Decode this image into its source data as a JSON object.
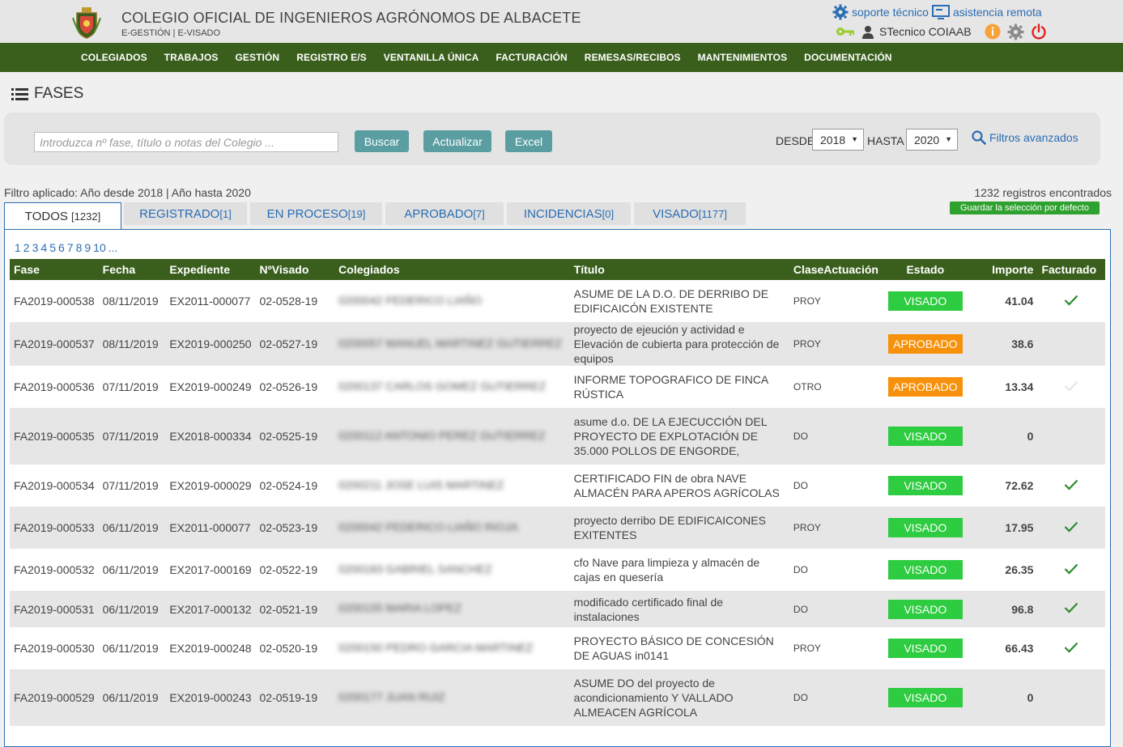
{
  "header": {
    "org_title": "COLEGIO OFICIAL DE INGENIEROS AGRÓNOMOS DE ALBACETE",
    "org_sub": "E-GESTIÓN | E-VISADO",
    "support_link": "soporte técnico",
    "remote_link": "asistencia remota",
    "username": "STecnico COIAAB"
  },
  "nav": {
    "items": [
      "COLEGIADOS",
      "TRABAJOS",
      "GESTIÓN",
      "REGISTRO E/S",
      "VENTANILLA ÚNICA",
      "FACTURACIÓN",
      "REMESAS/RECIBOS",
      "MANTENIMIENTOS",
      "DOCUMENTACIÓN"
    ]
  },
  "page": {
    "title": "FASES"
  },
  "search": {
    "placeholder": "Introduzca nº fase, título o notas del Colegio ...",
    "buscar": "Buscar",
    "actualizar": "Actualizar",
    "excel": "Excel",
    "desde_label": "DESDE",
    "desde_value": "2018",
    "hasta_label": "HASTA",
    "hasta_value": "2020",
    "advanced": "Filtros avanzados"
  },
  "filter": {
    "applied": "Filtro aplicado: Año desde 2018 | Año hasta 2020",
    "records": "1232 registros encontrados",
    "save_default": "Guardar la selección por defecto"
  },
  "tabs": [
    {
      "label": "TODOS ",
      "count": "[1232]"
    },
    {
      "label": "REGISTRADO",
      "count": "[1]"
    },
    {
      "label": "EN PROCESO",
      "count": "[19]"
    },
    {
      "label": "APROBADO",
      "count": "[7]"
    },
    {
      "label": "INCIDENCIAS",
      "count": "[0]"
    },
    {
      "label": "VISADO",
      "count": "[1177]"
    }
  ],
  "pager": [
    "1",
    "2",
    "3",
    "4",
    "5",
    "6",
    "7",
    "8",
    "9",
    "10",
    "..."
  ],
  "table": {
    "columns": [
      "Fase",
      "Fecha",
      "Expediente",
      "NºVisado",
      "Colegiados",
      "Título",
      "ClaseActuación",
      "Estado",
      "Importe",
      "Facturado"
    ],
    "rows": [
      {
        "fase": "FA2019-000538",
        "fecha": "08/11/2019",
        "expediente": "EX2011-000077",
        "visado": "02-0528-19",
        "colegiados": "0200042 FEDERICO LIAÑO",
        "titulo": "ASUME DE LA D.O. DE DERRIBO DE EDIFICAICÓN EXISTENTE",
        "clase": "PROY",
        "estado": "VISADO",
        "importe": "41.04",
        "facturado": true
      },
      {
        "fase": "FA2019-000537",
        "fecha": "08/11/2019",
        "expediente": "EX2019-000250",
        "visado": "02-0527-19",
        "colegiados": "0200057 MANUEL MARTINEZ GUTIERREZ",
        "titulo": "proyecto de ejeución y actividad e Elevación de cubierta para protección de equipos",
        "clase": "PROY",
        "estado": "APROBADO",
        "importe": "38.6",
        "facturado": false
      },
      {
        "fase": "FA2019-000536",
        "fecha": "07/11/2019",
        "expediente": "EX2019-000249",
        "visado": "02-0526-19",
        "colegiados": "0200137 CARLOS GOMEZ GUTIERREZ",
        "titulo": "INFORME TOPOGRAFICO DE FINCA RÚSTICA",
        "clase": "OTRO",
        "estado": "APROBADO",
        "importe": "13.34",
        "facturado": false
      },
      {
        "fase": "FA2019-000535",
        "fecha": "07/11/2019",
        "expediente": "EX2018-000334",
        "visado": "02-0525-19",
        "colegiados": "0200112 ANTONIO PEREZ GUTIERREZ",
        "titulo": "asume d.o. DE LA EJECUCCIÓN DEL PROYECTO DE EXPLOTACIÓN DE 35.000 POLLOS DE ENGORDE,",
        "clase": "DO",
        "estado": "VISADO",
        "importe": "0",
        "facturado": false
      },
      {
        "fase": "FA2019-000534",
        "fecha": "07/11/2019",
        "expediente": "EX2019-000029",
        "visado": "02-0524-19",
        "colegiados": "0200211 JOSE LUIS MARTINEZ",
        "titulo": "CERTIFICADO FIN de obra NAVE ALMACÉN PARA APEROS AGRÍCOLAS",
        "clase": "DO",
        "estado": "VISADO",
        "importe": "72.62",
        "facturado": true
      },
      {
        "fase": "FA2019-000533",
        "fecha": "06/11/2019",
        "expediente": "EX2011-000077",
        "visado": "02-0523-19",
        "colegiados": "0200042 FEDERICO LIAÑO RIOJA",
        "titulo": "proyecto derribo DE EDIFICAICONES EXITENTES",
        "clase": "PROY",
        "estado": "VISADO",
        "importe": "17.95",
        "facturado": true
      },
      {
        "fase": "FA2019-000532",
        "fecha": "06/11/2019",
        "expediente": "EX2017-000169",
        "visado": "02-0522-19",
        "colegiados": "0200183 GABRIEL SANCHEZ",
        "titulo": "cfo Nave para limpieza y almacén de cajas en quesería",
        "clase": "DO",
        "estado": "VISADO",
        "importe": "26.35",
        "facturado": true
      },
      {
        "fase": "FA2019-000531",
        "fecha": "06/11/2019",
        "expediente": "EX2017-000132",
        "visado": "02-0521-19",
        "colegiados": "0200155 MARIA LOPEZ",
        "titulo": "modificado certificado final de instalaciones",
        "clase": "DO",
        "estado": "VISADO",
        "importe": "96.8",
        "facturado": true
      },
      {
        "fase": "FA2019-000530",
        "fecha": "06/11/2019",
        "expediente": "EX2019-000248",
        "visado": "02-0520-19",
        "colegiados": "0200150 PEDRO GARCIA MARTINEZ",
        "titulo": "PROYECTO BÁSICO DE CONCESIÓN DE AGUAS in0141",
        "clase": "PROY",
        "estado": "VISADO",
        "importe": "66.43",
        "facturado": true
      },
      {
        "fase": "FA2019-000529",
        "fecha": "06/11/2019",
        "expediente": "EX2019-000243",
        "visado": "02-0519-19",
        "colegiados": "0200177 JUAN RUIZ",
        "titulo": "ASUME DO del proyecto de acondicionamiento Y VALLADO ALMEACEN AGRÍCOLA",
        "clase": "DO",
        "estado": "VISADO",
        "importe": "0",
        "facturado": false
      }
    ]
  },
  "colors": {
    "nav_green": "#3a5f1d",
    "link_blue": "#2a6db3",
    "visado_green": "#2ecc40",
    "aprobado_orange": "#f7900a",
    "teal_button": "#5a9ea2",
    "check_green": "#2e8b2e"
  },
  "icons": {
    "support": "gear-icon",
    "remote": "monitor-icon",
    "key": "key-icon",
    "user": "user-icon",
    "info": "info-icon",
    "settings": "gear-icon",
    "power": "power-icon",
    "list": "list-icon",
    "search": "search-icon",
    "check": "check-icon"
  }
}
